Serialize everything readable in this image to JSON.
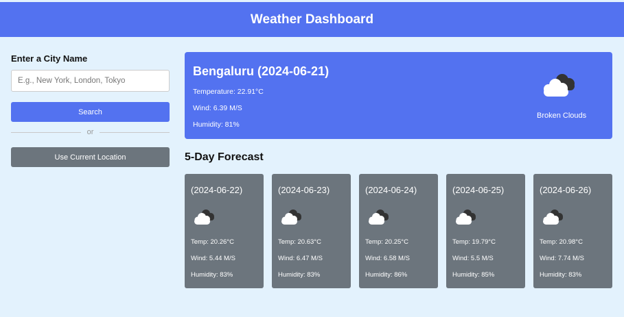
{
  "header": {
    "title": "Weather Dashboard"
  },
  "sidebar": {
    "title": "Enter a City Name",
    "input_placeholder": "E.g., New York, London, Tokyo",
    "input_value": "",
    "search_label": "Search",
    "divider_label": "or",
    "location_label": "Use Current Location"
  },
  "current": {
    "title": "Bengaluru (2024-06-21)",
    "temperature": "Temperature: 22.91°C",
    "wind": "Wind: 6.39 M/S",
    "humidity": "Humidity: 81%",
    "icon": "broken-clouds-icon",
    "description": "Broken Clouds"
  },
  "forecast": {
    "title": "5-Day Forecast",
    "days": [
      {
        "date": "(2024-06-22)",
        "temp": "Temp: 20.26°C",
        "wind": "Wind: 5.44 M/S",
        "humidity": "Humidity: 83%",
        "icon": "broken-clouds-icon"
      },
      {
        "date": "(2024-06-23)",
        "temp": "Temp: 20.63°C",
        "wind": "Wind: 6.47 M/S",
        "humidity": "Humidity: 83%",
        "icon": "broken-clouds-icon"
      },
      {
        "date": "(2024-06-24)",
        "temp": "Temp: 20.25°C",
        "wind": "Wind: 6.58 M/S",
        "humidity": "Humidity: 86%",
        "icon": "broken-clouds-icon"
      },
      {
        "date": "(2024-06-25)",
        "temp": "Temp: 19.79°C",
        "wind": "Wind: 5.5 M/S",
        "humidity": "Humidity: 85%",
        "icon": "broken-clouds-icon"
      },
      {
        "date": "(2024-06-26)",
        "temp": "Temp: 20.98°C",
        "wind": "Wind: 7.74 M/S",
        "humidity": "Humidity: 83%",
        "icon": "broken-clouds-icon"
      }
    ]
  },
  "colors": {
    "accent": "#5372f0",
    "card": "#6c757d",
    "background": "#e3f2fd"
  }
}
